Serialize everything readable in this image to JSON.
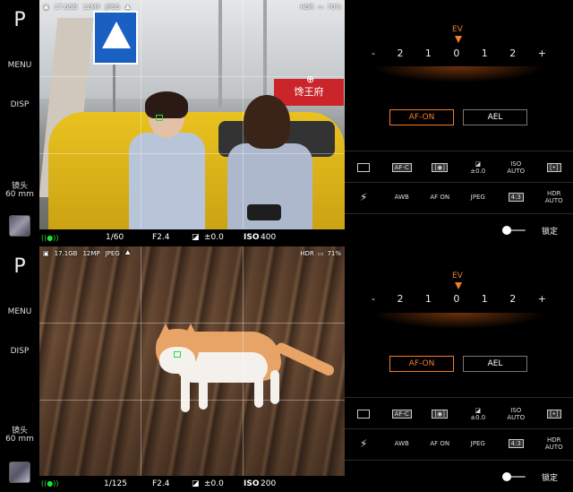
{
  "panels": [
    {
      "mode": "P",
      "menu": "MENU",
      "disp": "DISP",
      "lens_label": "镜头",
      "lens_value": "60 mm",
      "status": {
        "storage": "17.6GB",
        "megapixels": "12MP",
        "format": "JPEG",
        "hdr": "HDR",
        "battery": "70%"
      },
      "sign_text": "馋王府",
      "bottom": {
        "shutter": "1/60",
        "aperture": "F2.4",
        "ev": "±0.0",
        "iso_label": "ISO",
        "iso_value": "400"
      },
      "controls": {
        "ev_label": "EV",
        "scale": [
          "-",
          "2",
          "1",
          "0",
          "1",
          "2",
          "+"
        ],
        "af_on": "AF-ON",
        "ael": "AEL",
        "row1": [
          "drive",
          "AF-C",
          "metering",
          "±0.0",
          "ISO AUTO",
          "focus-area"
        ],
        "row2": [
          "flash",
          "AWB",
          "AF ON",
          "JPEG",
          "4:3",
          "HDR AUTO"
        ],
        "lock": "锁定"
      }
    },
    {
      "mode": "P",
      "menu": "MENU",
      "disp": "DISP",
      "lens_label": "镜头",
      "lens_value": "60 mm",
      "status": {
        "storage": "17.1GB",
        "megapixels": "12MP",
        "format": "JPEG",
        "hdr": "HDR",
        "battery": "71%"
      },
      "bottom": {
        "shutter": "1/125",
        "aperture": "F2.4",
        "ev": "±0.0",
        "iso_label": "ISO",
        "iso_value": "200"
      },
      "controls": {
        "ev_label": "EV",
        "scale": [
          "-",
          "2",
          "1",
          "0",
          "1",
          "2",
          "+"
        ],
        "af_on": "AF-ON",
        "ael": "AEL",
        "row1": [
          "drive",
          "AF-C",
          "metering",
          "±0.0",
          "ISO AUTO",
          "focus-area"
        ],
        "row2": [
          "flash",
          "AWB",
          "AF ON",
          "JPEG",
          "4:3",
          "HDR AUTO"
        ],
        "lock": "锁定"
      }
    }
  ],
  "colors": {
    "accent": "#f37d28",
    "focus": "#22e03a",
    "background": "#000000"
  }
}
